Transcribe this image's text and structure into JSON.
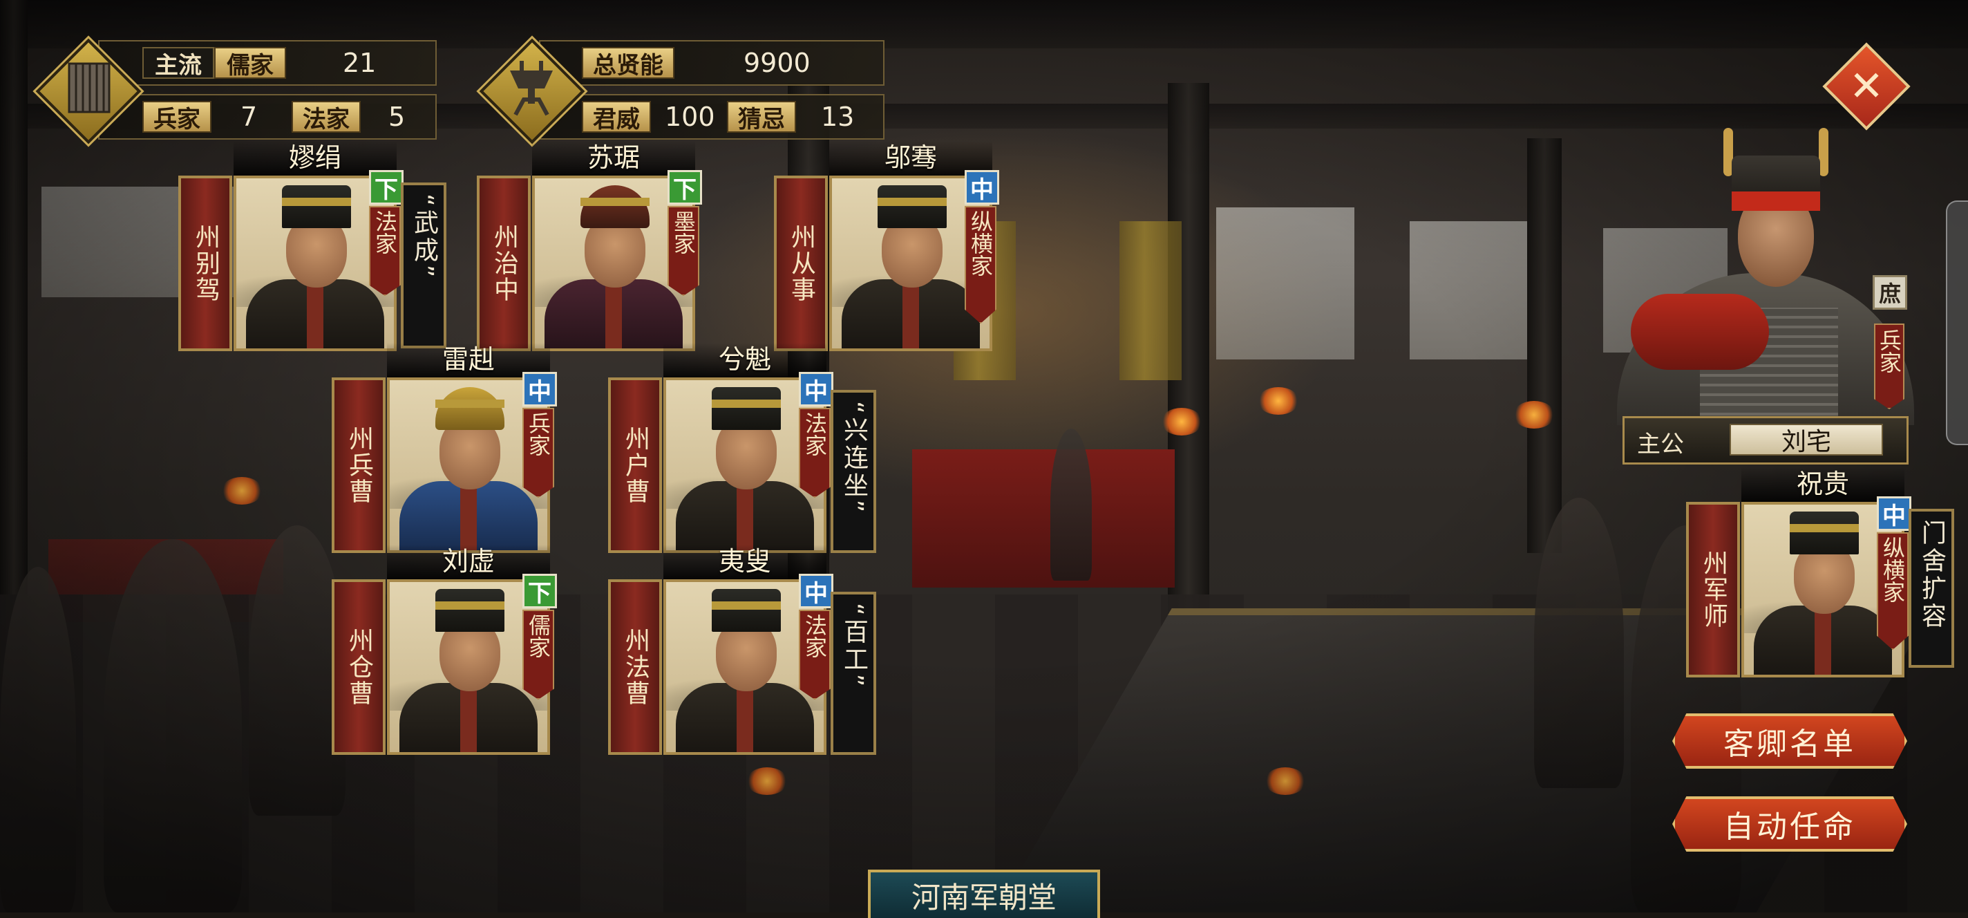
{
  "stats_left": {
    "mainstream_label": "主流",
    "mainstream_value": "儒家",
    "mainstream_count": "21",
    "bingjia_label": "兵家",
    "bingjia_count": "7",
    "fajia_label": "法家",
    "fajia_count": "5",
    "icon": "scroll-icon"
  },
  "stats_right": {
    "total_label": "总贤能",
    "total_value": "9900",
    "prestige_label": "君威",
    "prestige_value": "100",
    "suspicion_label": "猜忌",
    "suspicion_value": "13",
    "icon": "bronze-cup-icon"
  },
  "officials": [
    {
      "title": "州别驾",
      "name": "嫪绢",
      "rank": "下",
      "rank_color": "#3a9a34",
      "school": "法家",
      "trait": "“武成”"
    },
    {
      "title": "州治中",
      "name": "苏琚",
      "rank": "下",
      "rank_color": "#3a9a34",
      "school": "墨家",
      "trait": ""
    },
    {
      "title": "州从事",
      "name": "邬骞",
      "rank": "中",
      "rank_color": "#2c73b9",
      "school": "纵横家",
      "trait": ""
    },
    {
      "title": "州兵曹",
      "name": "雷赳",
      "rank": "中",
      "rank_color": "#2c73b9",
      "school": "兵家",
      "trait": ""
    },
    {
      "title": "州户曹",
      "name": "兮魁",
      "rank": "中",
      "rank_color": "#2c73b9",
      "school": "法家",
      "trait": "“兴连坐”"
    },
    {
      "title": "州仓曹",
      "name": "刘虚",
      "rank": "下",
      "rank_color": "#3a9a34",
      "school": "儒家",
      "trait": ""
    },
    {
      "title": "州法曹",
      "name": "夷叟",
      "rank": "中",
      "rank_color": "#2c73b9",
      "school": "法家",
      "trait": "“百工”"
    },
    {
      "title": "州军师",
      "name": "祝贵",
      "rank": "中",
      "rank_color": "#2c73b9",
      "school": "纵横家",
      "trait": "门舍扩容"
    }
  ],
  "lord": {
    "label": "主公",
    "name": "刘宅",
    "rank": "庶",
    "school": "兵家"
  },
  "buttons": {
    "close": "✕",
    "guest_list": "客卿名单",
    "auto_assign": "自动任命"
  },
  "court_title": "河南军朝堂"
}
